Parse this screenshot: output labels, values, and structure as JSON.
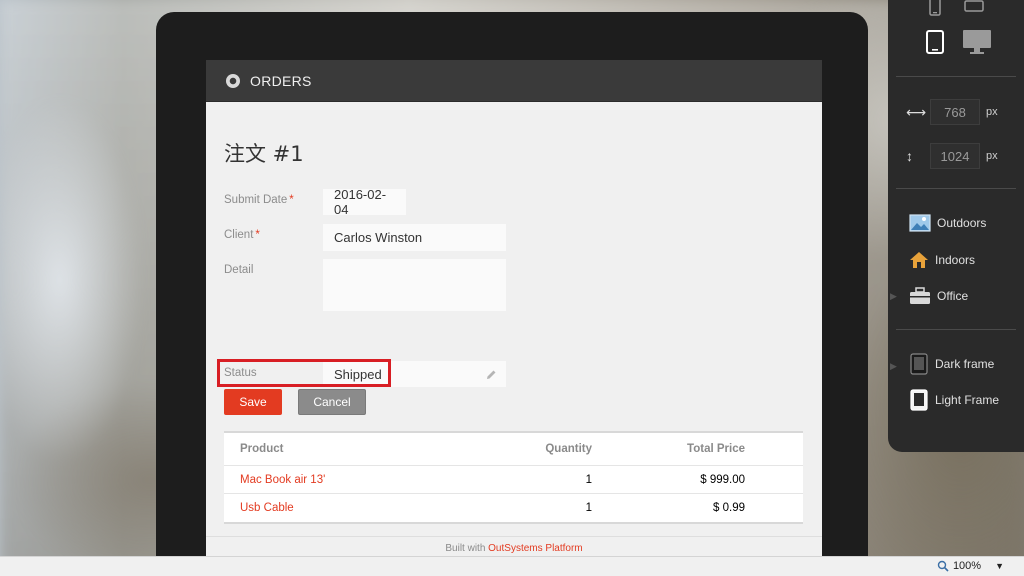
{
  "app": {
    "title": "ORDERS"
  },
  "page": {
    "title": "注文 #1"
  },
  "form": {
    "submit_date_label": "Submit Date",
    "submit_date_value": "2016-02-04",
    "client_label": "Client",
    "client_value": "Carlos Winston",
    "detail_label": "Detail",
    "detail_value": "",
    "status_label": "Status",
    "status_value": "Shipped",
    "required_mark": "*"
  },
  "buttons": {
    "save": "Save",
    "cancel": "Cancel"
  },
  "table": {
    "headers": [
      "Product",
      "Quantity",
      "Total Price"
    ],
    "rows": [
      {
        "product": "Mac Book air 13'",
        "quantity": "1",
        "total_price": "$ 999.00"
      },
      {
        "product": "Usb Cable",
        "quantity": "1",
        "total_price": "$ 0.99"
      }
    ]
  },
  "footer": {
    "prefix": "Built with",
    "link": "OutSystems Platform"
  },
  "panel": {
    "width_value": "768",
    "height_value": "1024",
    "unit": "px",
    "backgrounds": [
      "Outdoors",
      "Indoors",
      "Office"
    ],
    "frames": [
      "Dark frame",
      "Light Frame"
    ]
  },
  "statusbar": {
    "zoom": "100%"
  },
  "colors": {
    "accent": "#e33b21",
    "header": "#3a3a3a",
    "panel": "#2a2a2a",
    "highlight": "#d81e24"
  }
}
